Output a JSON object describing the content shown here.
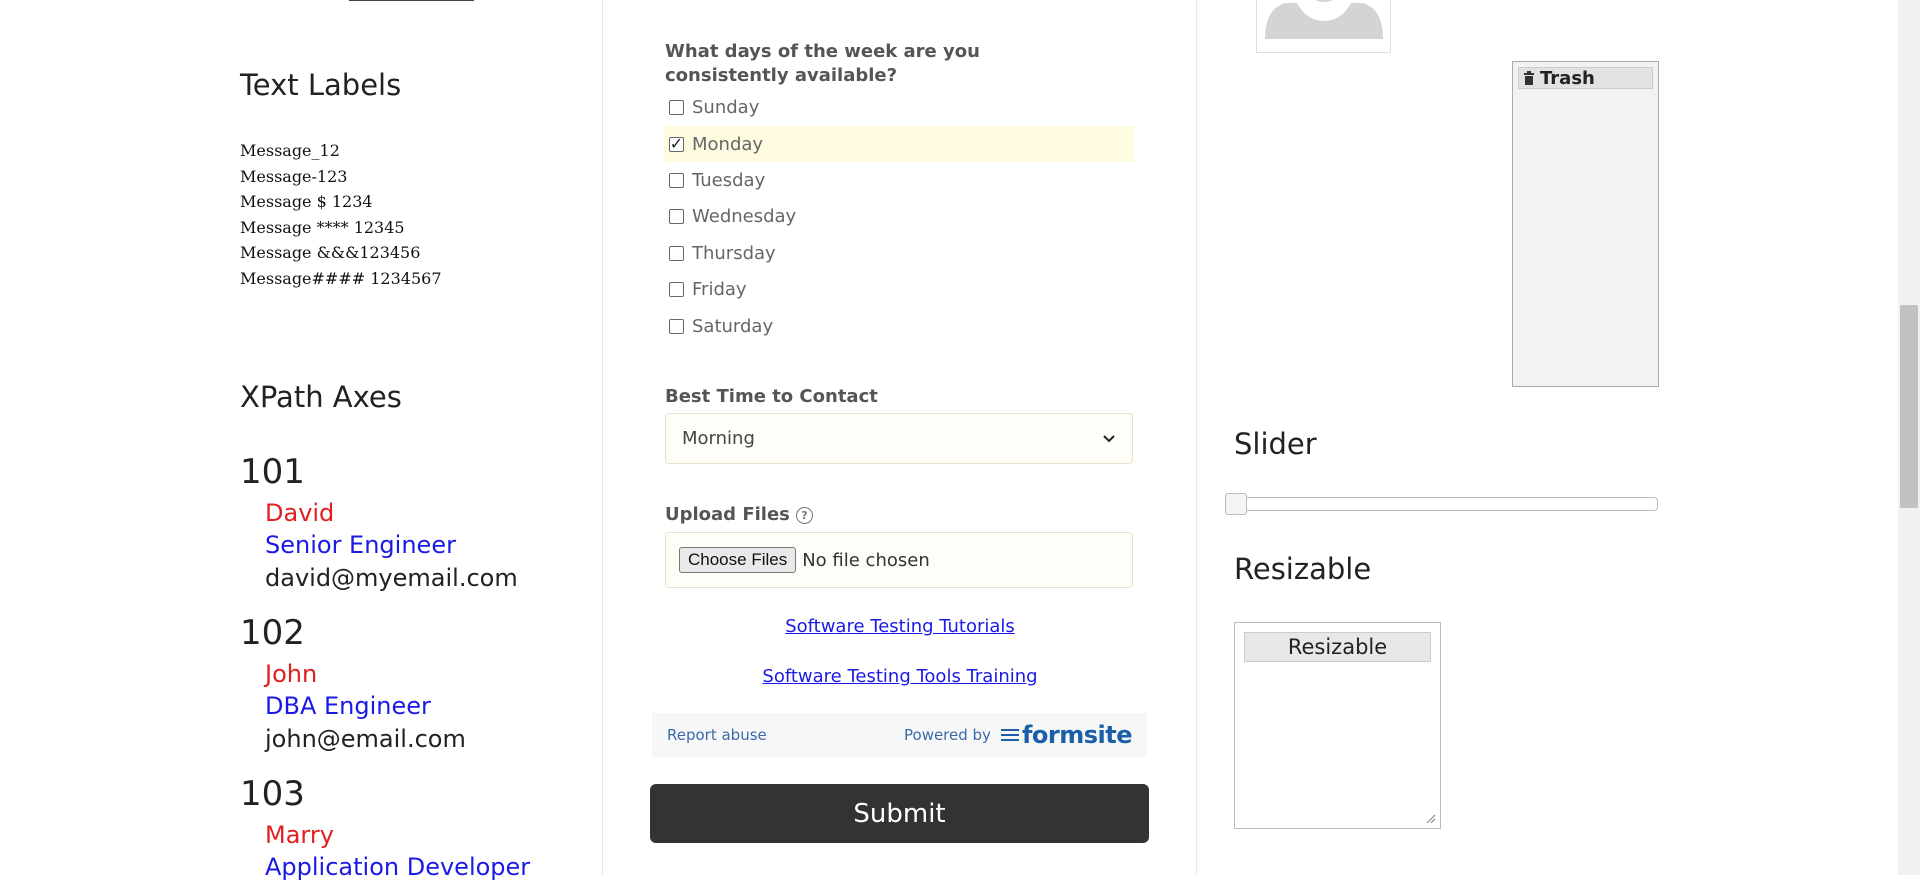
{
  "left": {
    "text_labels": {
      "title": "Text Labels",
      "messages": [
        "Message_12",
        "Message-123",
        "Message $ 1234",
        "Message **** 12345",
        "Message &&&123456",
        "Message#### 1234567"
      ]
    },
    "xpath": {
      "title": "XPath Axes",
      "entries": [
        {
          "id": "101",
          "name": "David",
          "role": "Senior Engineer",
          "email": "david@myemail.com"
        },
        {
          "id": "102",
          "name": "John",
          "role": "DBA Engineer",
          "email": "john@email.com"
        },
        {
          "id": "103",
          "name": "Marry",
          "role": "Application Developer"
        }
      ]
    }
  },
  "form": {
    "days_question": "What days of the week are you consistently available?",
    "days": [
      {
        "label": "Sunday",
        "checked": false
      },
      {
        "label": "Monday",
        "checked": true
      },
      {
        "label": "Tuesday",
        "checked": false
      },
      {
        "label": "Wednesday",
        "checked": false
      },
      {
        "label": "Thursday",
        "checked": false
      },
      {
        "label": "Friday",
        "checked": false
      },
      {
        "label": "Saturday",
        "checked": false
      }
    ],
    "check_mark": "✓",
    "best_time_label": "Best Time to Contact",
    "best_time_value": "Morning",
    "upload_label": "Upload Files",
    "help_glyph": "?",
    "choose_files": "Choose Files",
    "no_file": "No file chosen",
    "link1": "Software Testing Tutorials",
    "link2": "Software Testing Tools Training",
    "report_abuse": "Report abuse",
    "powered_by": "Powered by",
    "formsite": "formsite",
    "submit": "Submit"
  },
  "right": {
    "trash_label": "Trash",
    "slider_title": "Slider",
    "slider_value": 0,
    "resizable_title": "Resizable",
    "resizable_label": "Resizable"
  }
}
